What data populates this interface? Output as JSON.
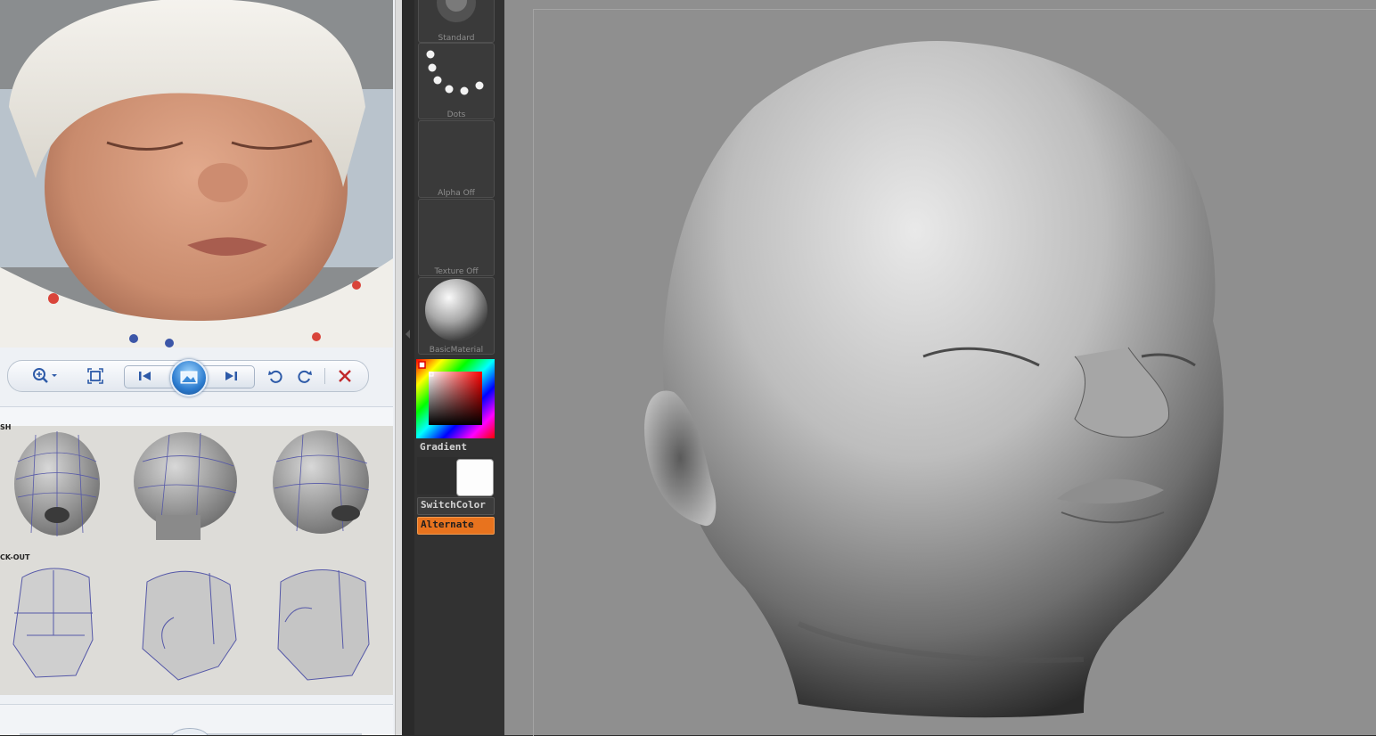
{
  "tray": {
    "brush_label": "Standard",
    "stroke_label": "Dots",
    "alpha_label": "Alpha  Off",
    "texture_label": "Texture  Off",
    "material_label": "BasicMaterial",
    "gradient_label": "Gradient",
    "switchcolor_label": "SwitchColor",
    "alternate_label": "Alternate"
  },
  "viewer": {
    "toolbar_icons": [
      "zoom-icon",
      "fit-screen-icon",
      "previous-icon",
      "slideshow-icon",
      "next-icon",
      "rotate-ccw-icon",
      "rotate-cw-icon",
      "delete-icon"
    ]
  },
  "reference_sheet": {
    "row1_label": "SH",
    "row2_label": "CK-OUT"
  },
  "colors": {
    "alternate_accent": "#e8731e",
    "viewport_bg": "#8f8f8f",
    "delete_red": "#c0282a"
  }
}
